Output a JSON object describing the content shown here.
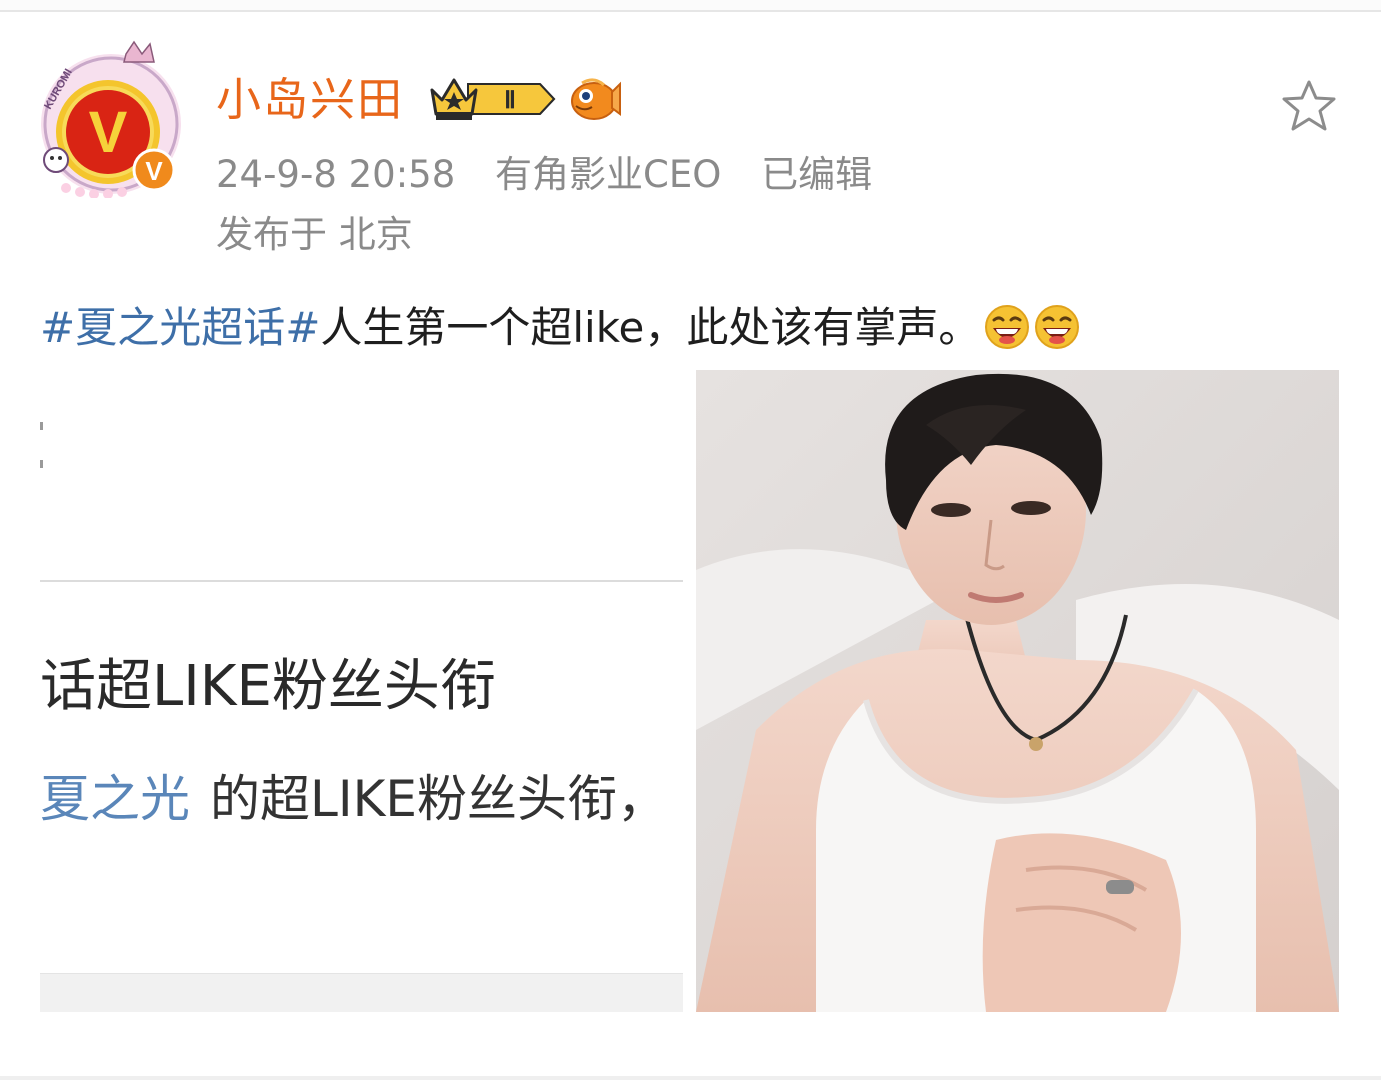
{
  "post": {
    "username": "小岛兴田",
    "timestamp": "24-9-8 20:58",
    "title": "有角影业CEO",
    "edited": "已编辑",
    "location": "发布于 北京",
    "topic": "#夏之光超话#",
    "text": "人生第一个超like，此处该有掌声。"
  },
  "badges": {
    "level": "Ⅱ"
  },
  "icons": {
    "favorite": "star-outline-icon",
    "emoji": "laughing-emoji-icon",
    "vip": "v-verified-badge",
    "crown": "crown-badge-icon",
    "pet": "fish-icon"
  },
  "images": {
    "left": {
      "title": "话超LIKE粉丝头衔",
      "desc_link": "夏之光",
      "desc_text": "的超LIKE粉丝头衔，"
    }
  },
  "colors": {
    "username": "#e8661a",
    "topic": "#3e6fa8",
    "meta": "#8a8a8a"
  }
}
